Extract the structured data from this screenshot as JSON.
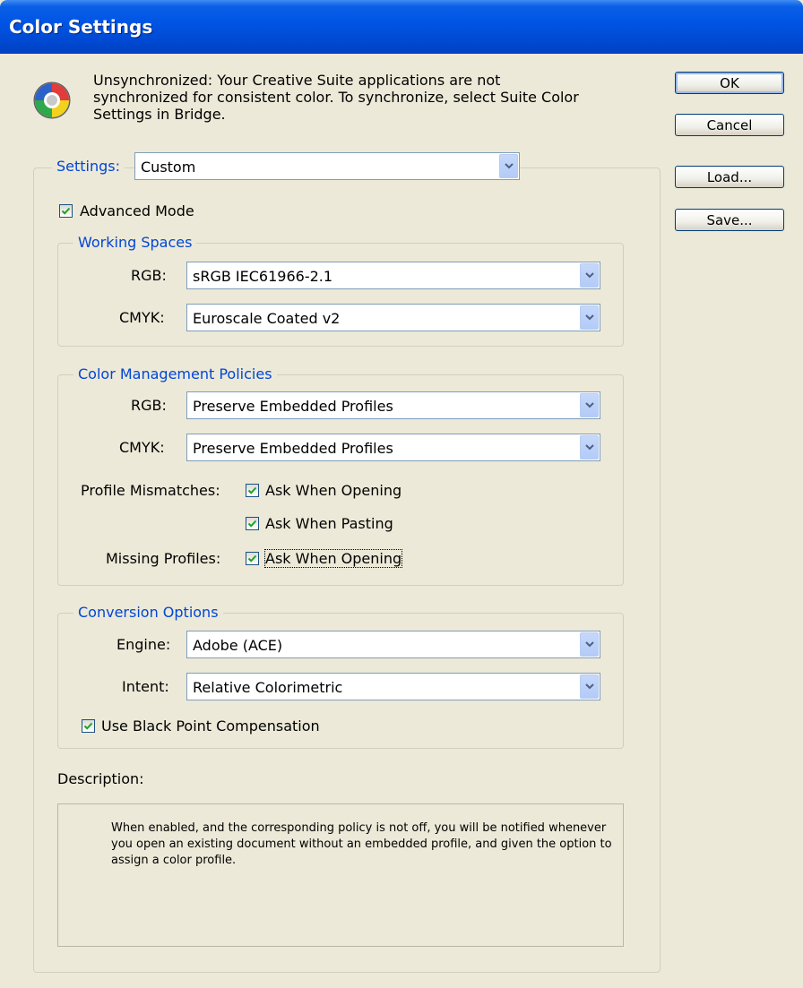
{
  "window": {
    "title": "Color Settings"
  },
  "message": "Unsynchronized: Your Creative Suite applications are not synchronized for consistent color. To synchronize, select Suite Color Settings in Bridge.",
  "buttons": {
    "ok": "OK",
    "cancel": "Cancel",
    "load": "Load...",
    "save": "Save..."
  },
  "settings": {
    "label": "Settings:",
    "value": "Custom"
  },
  "advanced_mode": {
    "label": "Advanced Mode",
    "checked": true
  },
  "working_spaces": {
    "title": "Working Spaces",
    "rgb_label": "RGB:",
    "rgb_value": "sRGB IEC61966-2.1",
    "cmyk_label": "CMYK:",
    "cmyk_value": "Euroscale Coated v2"
  },
  "policies": {
    "title": "Color Management Policies",
    "rgb_label": "RGB:",
    "rgb_value": "Preserve Embedded Profiles",
    "cmyk_label": "CMYK:",
    "cmyk_value": "Preserve Embedded Profiles",
    "mismatch_label": "Profile Mismatches:",
    "mismatch_opening": "Ask When Opening",
    "mismatch_pasting": "Ask When Pasting",
    "missing_label": "Missing Profiles:",
    "missing_opening": "Ask When Opening"
  },
  "conversion": {
    "title": "Conversion Options",
    "engine_label": "Engine:",
    "engine_value": "Adobe (ACE)",
    "intent_label": "Intent:",
    "intent_value": "Relative Colorimetric",
    "bpc_label": "Use Black Point Compensation"
  },
  "description": {
    "label": "Description:",
    "text": "When enabled, and the corresponding policy is not off, you will be notified whenever you open an existing document without an embedded profile, and given the option to assign a color profile."
  },
  "colors": {
    "titlebar": "#0055e5",
    "dialog_bg": "#ece9d8",
    "group_title": "#0046d5",
    "check": "#21a121"
  },
  "icons": {
    "app_icon": "color-wheel-icon",
    "dropdown": "chevron-down-icon",
    "check": "checkmark-icon"
  }
}
